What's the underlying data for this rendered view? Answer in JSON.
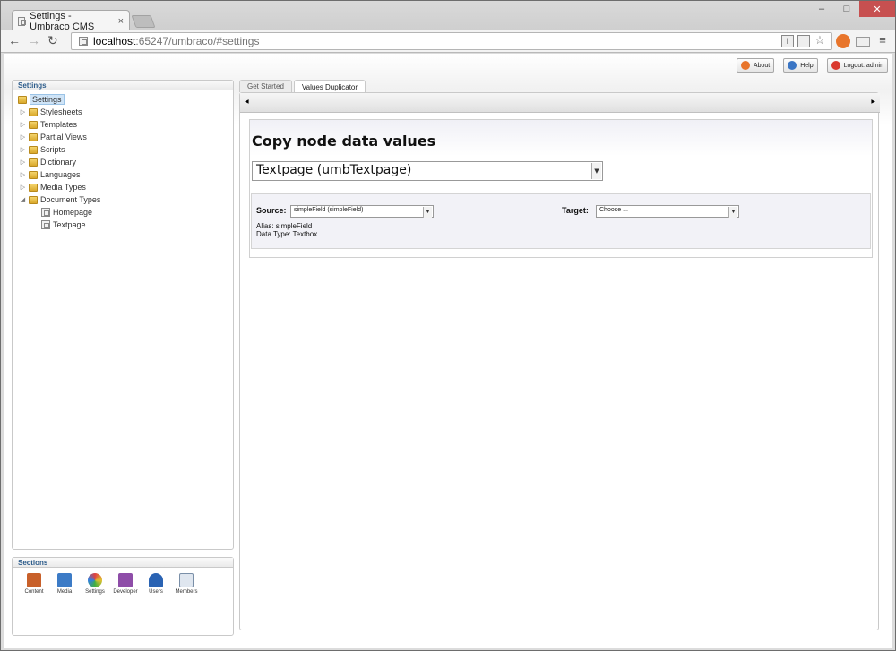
{
  "browser": {
    "tab_title": "Settings - Umbraco CMS",
    "tab_close": "×",
    "url_host": "localhost",
    "url_path": ":65247/umbraco/#settings",
    "window_buttons": [
      "–",
      "□",
      "✕"
    ]
  },
  "header": {
    "buttons": [
      {
        "label": "About",
        "color": "#e8752b"
      },
      {
        "label": "Help",
        "color": "#3a75c4"
      },
      {
        "label": "Logout: admin",
        "color": "#d9382d"
      }
    ]
  },
  "tree_panel": {
    "title": "Settings",
    "root": "Settings",
    "items": [
      {
        "label": "Stylesheets"
      },
      {
        "label": "Templates"
      },
      {
        "label": "Partial Views"
      },
      {
        "label": "Scripts"
      },
      {
        "label": "Dictionary"
      },
      {
        "label": "Languages"
      },
      {
        "label": "Media Types"
      },
      {
        "label": "Document Types"
      }
    ],
    "children": [
      {
        "label": "Homepage"
      },
      {
        "label": "Textpage"
      }
    ]
  },
  "sections_panel": {
    "title": "Sections",
    "items": [
      {
        "label": "Content",
        "color": "#c8602a"
      },
      {
        "label": "Media",
        "color": "#3c7bc6"
      },
      {
        "label": "Settings",
        "color": "#e0a22a"
      },
      {
        "label": "Developer",
        "color": "#8e4da8"
      },
      {
        "label": "Users",
        "color": "#2a63b3"
      },
      {
        "label": "Members",
        "color": "#7a8fa8"
      }
    ]
  },
  "content": {
    "tabs": [
      {
        "label": "Get Started"
      },
      {
        "label": "Values Duplicator"
      }
    ],
    "heading": "Copy node data values",
    "doc_type_select": "Textpage (umbTextpage)",
    "source_label": "Source:",
    "source_value": "simpleField (simpleField)",
    "target_label": "Target:",
    "target_value": "Choose ...",
    "alias_line": "Alias: simpleField",
    "datatype_line": "Data Type: Textbox"
  }
}
